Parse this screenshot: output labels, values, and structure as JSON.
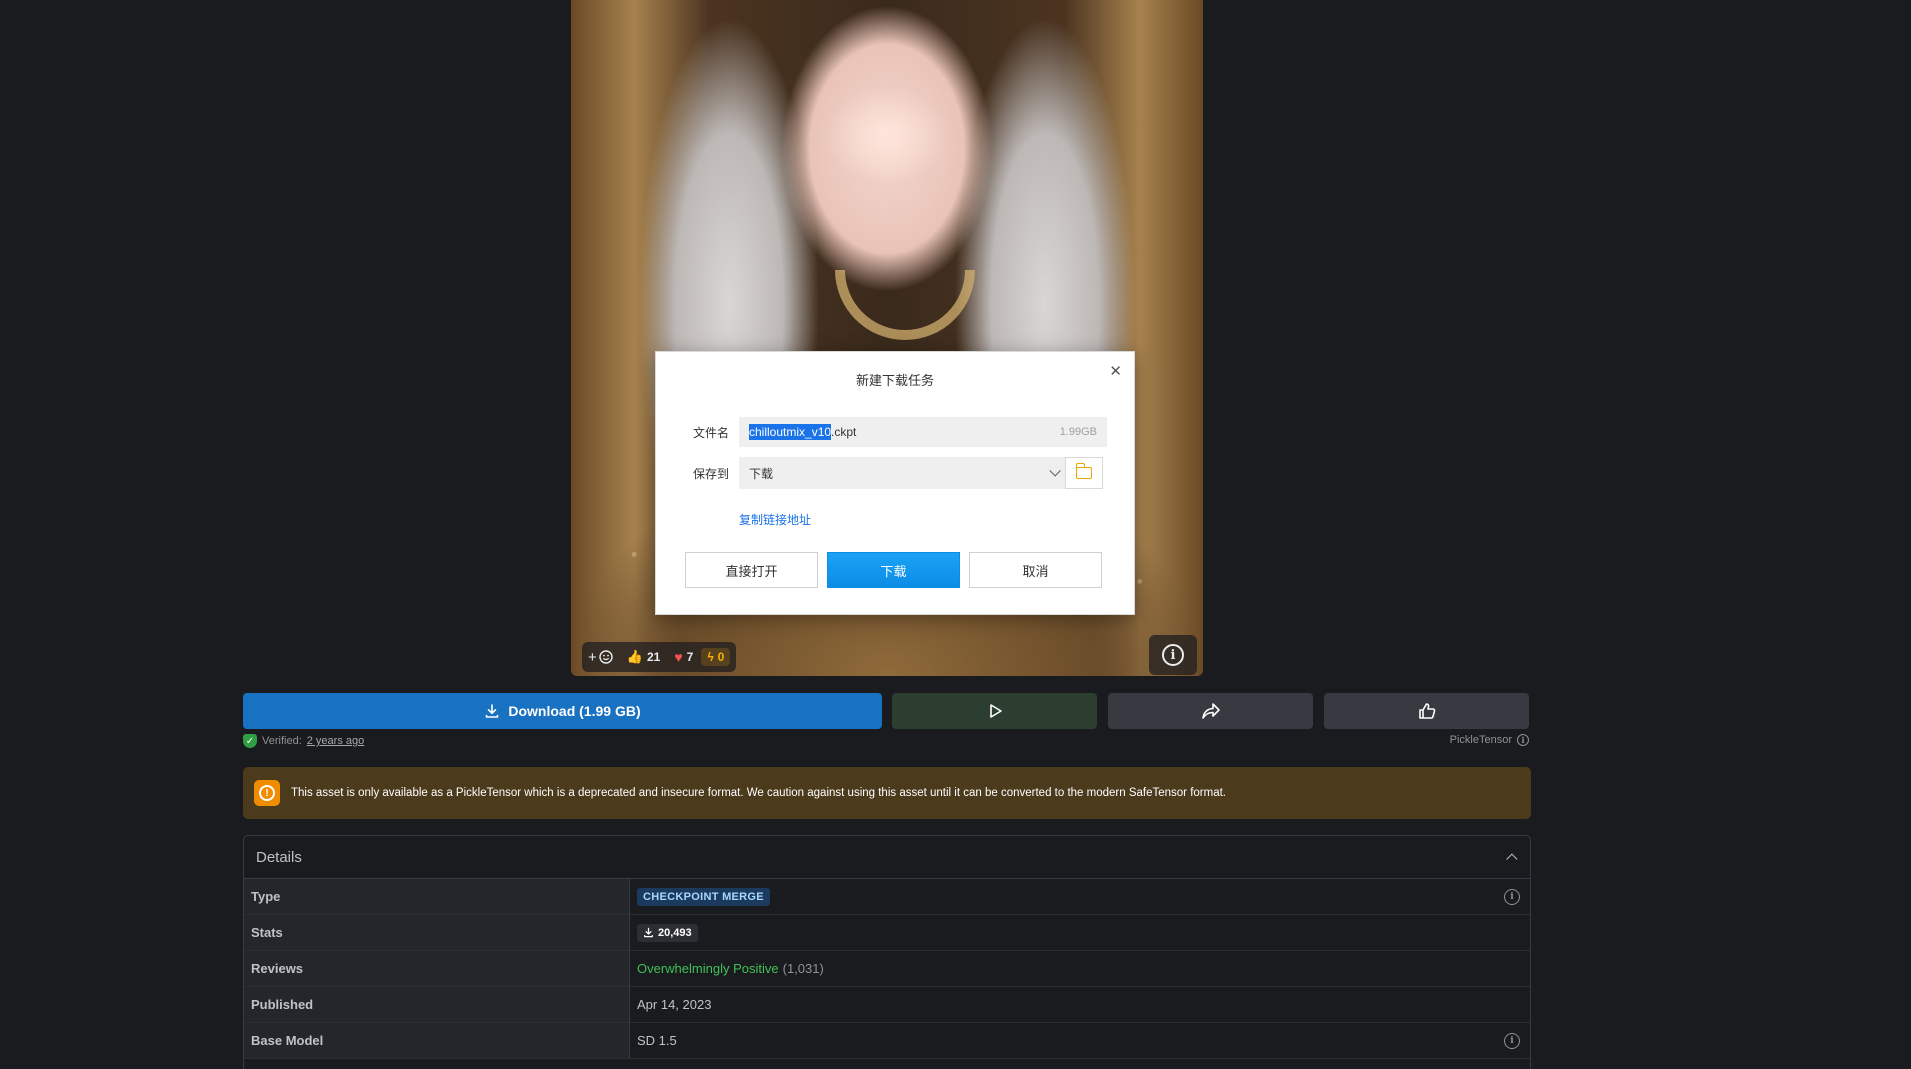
{
  "reactions": {
    "add_symbol": "+",
    "likes": "21",
    "hearts": "7",
    "bolts": "0"
  },
  "dialog": {
    "title": "新建下载任务",
    "close_symbol": "✕",
    "filename_label": "文件名",
    "filename_selected": "chilloutmix_v10",
    "filename_rest": ".ckpt",
    "file_size": "1.99GB",
    "save_to_label": "保存到",
    "save_to_value": "下载",
    "copy_link": "复制链接地址",
    "btn_open": "直接打开",
    "btn_download": "下载",
    "btn_cancel": "取消"
  },
  "actions": {
    "download_label": "Download (1.99 GB)",
    "play_icon": "play-icon",
    "share_icon": "share-icon",
    "like_icon": "thumbs-up-icon"
  },
  "meta": {
    "verified_prefix": "Verified:",
    "verified_ago": "2 years ago",
    "format": "PickleTensor"
  },
  "warning": {
    "text": "This asset is only available as a PickleTensor which is a deprecated and insecure format. We caution against using this asset until it can be converted to the modern SafeTensor format."
  },
  "details": {
    "title": "Details",
    "rows": [
      {
        "key": "Type",
        "value": "CHECKPOINT MERGE"
      },
      {
        "key": "Stats",
        "value": "20,493"
      },
      {
        "key": "Reviews",
        "value": "Overwhelmingly Positive",
        "count": "(1,031)"
      },
      {
        "key": "Published",
        "value": "Apr 14, 2023"
      },
      {
        "key": "Base Model",
        "value": "SD 1.5"
      }
    ]
  },
  "colors": {
    "background": "#1a1b1e",
    "download_button": "#1971c2",
    "play_button": "#2b3e30",
    "warning_bg": "#4b3a1c",
    "warning_icon": "#f08c00",
    "positive": "#40c057",
    "dialog_primary": "#0d8ce6"
  }
}
